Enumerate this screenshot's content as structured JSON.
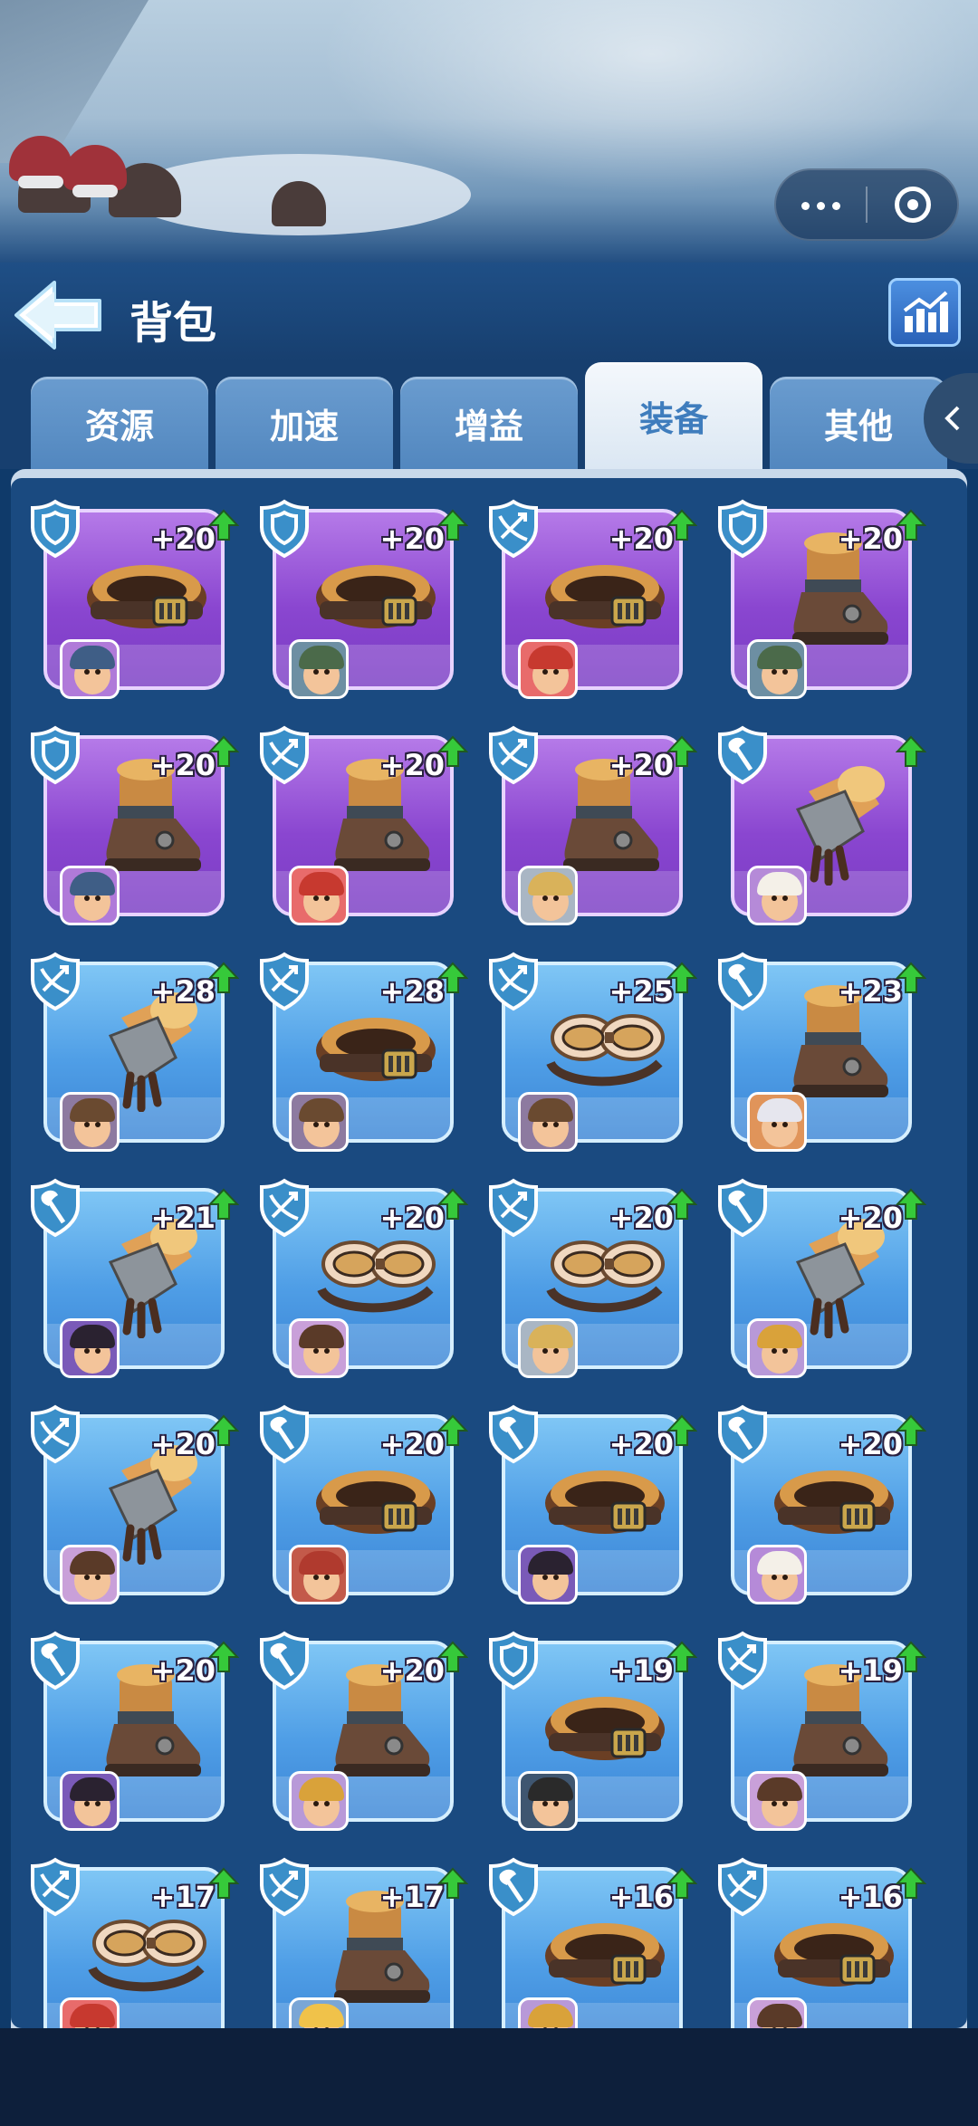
{
  "header": {
    "title": "背包"
  },
  "tabs": [
    {
      "label": "资源",
      "active": false
    },
    {
      "label": "加速",
      "active": false
    },
    {
      "label": "增益",
      "active": false
    },
    {
      "label": "装备",
      "active": true
    },
    {
      "label": "其他",
      "active": false
    }
  ],
  "colors": {
    "epic": "#8a46d0",
    "rare": "#4f9ee6",
    "header_bg": "#173f6f",
    "panel_bg": "#1a4a80",
    "upgrade_arrow": "#36c93a"
  },
  "items": [
    {
      "bonus": "+20",
      "rarity": "epic",
      "class_icon": "shield-icon",
      "gear": "belt",
      "hero": "dwarf-blue-helmet"
    },
    {
      "bonus": "+20",
      "rarity": "epic",
      "class_icon": "shield-icon",
      "gear": "belt",
      "hero": "dwarf-green-helmet"
    },
    {
      "bonus": "+20",
      "rarity": "epic",
      "class_icon": "crossbow-icon",
      "gear": "belt",
      "hero": "red-hair-girl"
    },
    {
      "bonus": "+20",
      "rarity": "epic",
      "class_icon": "shield-icon",
      "gear": "boot",
      "hero": "dwarf-green-helmet"
    },
    {
      "bonus": "+20",
      "rarity": "epic",
      "class_icon": "shield-icon",
      "gear": "boot",
      "hero": "dwarf-blue-helmet"
    },
    {
      "bonus": "+20",
      "rarity": "epic",
      "class_icon": "crossbow-icon",
      "gear": "boot",
      "hero": "red-hair-girl"
    },
    {
      "bonus": "+20",
      "rarity": "epic",
      "class_icon": "crossbow-icon",
      "gear": "boot",
      "hero": "goggles-man"
    },
    {
      "bonus": "",
      "rarity": "epic",
      "class_icon": "axe-icon",
      "gear": "gauntlet",
      "hero": "chef-man"
    },
    {
      "bonus": "+28",
      "rarity": "rare",
      "class_icon": "crossbow-icon",
      "gear": "gauntlet",
      "hero": "aviator-man"
    },
    {
      "bonus": "+28",
      "rarity": "rare",
      "class_icon": "crossbow-icon",
      "gear": "belt",
      "hero": "aviator-man"
    },
    {
      "bonus": "+25",
      "rarity": "rare",
      "class_icon": "crossbow-icon",
      "gear": "goggles",
      "hero": "aviator-man"
    },
    {
      "bonus": "+23",
      "rarity": "rare",
      "class_icon": "axe-icon",
      "gear": "boot",
      "hero": "white-hair-girl"
    },
    {
      "bonus": "+21",
      "rarity": "rare",
      "class_icon": "axe-icon",
      "gear": "gauntlet",
      "hero": "dark-hair-man"
    },
    {
      "bonus": "+20",
      "rarity": "rare",
      "class_icon": "crossbow-icon",
      "gear": "goggles",
      "hero": "brown-hair-girl"
    },
    {
      "bonus": "+20",
      "rarity": "rare",
      "class_icon": "crossbow-icon",
      "gear": "goggles",
      "hero": "goggles-man"
    },
    {
      "bonus": "+20",
      "rarity": "rare",
      "class_icon": "axe-icon",
      "gear": "gauntlet",
      "hero": "viking-man"
    },
    {
      "bonus": "+20",
      "rarity": "rare",
      "class_icon": "crossbow-icon",
      "gear": "gauntlet",
      "hero": "brown-hair-girl"
    },
    {
      "bonus": "+20",
      "rarity": "rare",
      "class_icon": "axe-icon",
      "gear": "belt",
      "hero": "bandana-man"
    },
    {
      "bonus": "+20",
      "rarity": "rare",
      "class_icon": "axe-icon",
      "gear": "belt",
      "hero": "dark-hair-man"
    },
    {
      "bonus": "+20",
      "rarity": "rare",
      "class_icon": "axe-icon",
      "gear": "belt",
      "hero": "chef-man"
    },
    {
      "bonus": "+20",
      "rarity": "rare",
      "class_icon": "axe-icon",
      "gear": "boot",
      "hero": "dark-hair-man"
    },
    {
      "bonus": "+20",
      "rarity": "rare",
      "class_icon": "axe-icon",
      "gear": "boot",
      "hero": "viking-man"
    },
    {
      "bonus": "+19",
      "rarity": "rare",
      "class_icon": "shield-icon",
      "gear": "belt",
      "hero": "goggles-miner"
    },
    {
      "bonus": "+19",
      "rarity": "rare",
      "class_icon": "crossbow-icon",
      "gear": "boot",
      "hero": "brown-hair-girl"
    },
    {
      "bonus": "+17",
      "rarity": "rare",
      "class_icon": "crossbow-icon",
      "gear": "goggles",
      "hero": "red-hair-girl"
    },
    {
      "bonus": "+17",
      "rarity": "rare",
      "class_icon": "crossbow-icon",
      "gear": "boot",
      "hero": "blonde-girl"
    },
    {
      "bonus": "+16",
      "rarity": "rare",
      "class_icon": "axe-icon",
      "gear": "belt",
      "hero": "viking-man"
    },
    {
      "bonus": "+16",
      "rarity": "rare",
      "class_icon": "crossbow-icon",
      "gear": "belt",
      "hero": "brown-hair-girl"
    }
  ]
}
